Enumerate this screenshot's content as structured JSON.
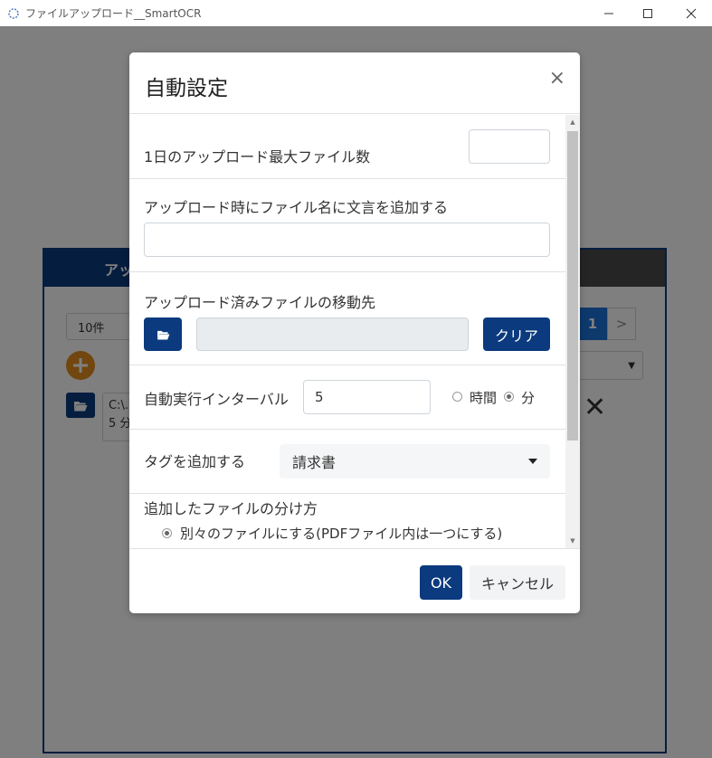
{
  "window": {
    "title": "ファイルアップロード__SmartOCR",
    "icons": [
      "app-icon",
      "minimize-icon",
      "maximize-icon",
      "close-icon"
    ]
  },
  "background": {
    "tab_label": "アッ",
    "count_select": "10件",
    "path_line1": "C:\\...",
    "path_line2": "5 分",
    "page_current": "1",
    "page_next": ">",
    "colors": {
      "brand": "#0b3a7e",
      "add": "#e28c1e",
      "active_page": "#1a73d9"
    }
  },
  "modal": {
    "title": "自動設定",
    "close_label": "×",
    "max_files": {
      "label": "1日のアップロード最大ファイル数",
      "value": ""
    },
    "append_text": {
      "label": "アップロード時にファイル名に文言を追加する",
      "value": ""
    },
    "move_dest": {
      "label": "アップロード済みファイルの移動先",
      "path": "",
      "clear_label": "クリア"
    },
    "interval": {
      "label": "自動実行インターバル",
      "value": "5",
      "unit_hour": "時間",
      "unit_minute": "分",
      "selected_unit": "分"
    },
    "tag": {
      "label": "タグを追加する",
      "selected": "請求書"
    },
    "split": {
      "label": "追加したファイルの分け方",
      "option1": "別々のファイルにする(PDFファイル内は一つにする)"
    },
    "ok_label": "OK",
    "cancel_label": "キャンセル"
  }
}
